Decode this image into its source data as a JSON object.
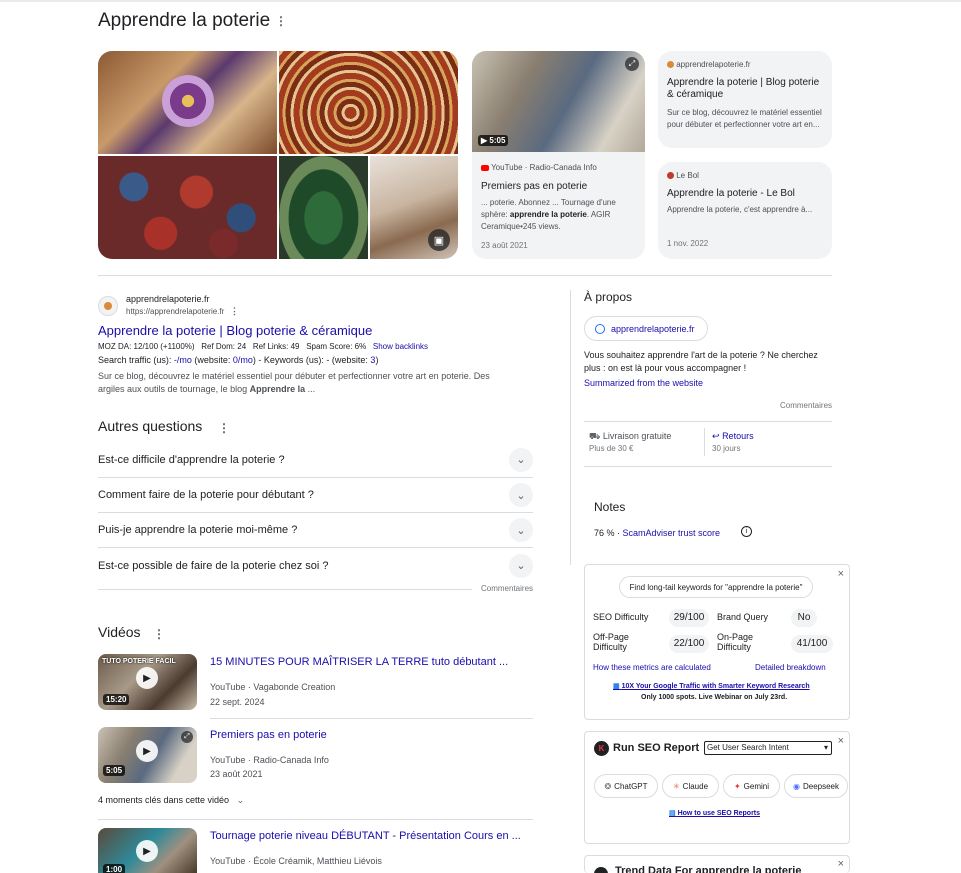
{
  "header": {
    "title": "Apprendre la poterie"
  },
  "images_panel": {
    "video_card": {
      "duration": "5:05",
      "source": "YouTube · Radio-Canada Info",
      "title": "Premiers pas en poterie",
      "snippet_a": "... poterie. Abonnez ... Tournage d'une sphère: ",
      "snippet_bold": "apprendre la poterie",
      "snippet_b": ". AGIR Ceramique•245 views.",
      "date": "23 août 2021"
    },
    "card1": {
      "site": "apprendrelapoterie.fr",
      "title": "Apprendre la poterie | Blog poterie & céramique",
      "snippet": "Sur ce blog, découvrez le matériel essentiel pour débuter et perfectionner votre art en..."
    },
    "card2": {
      "site": "Le Bol",
      "title": "Apprendre la poterie - Le Bol",
      "snippet": "Apprendre la poterie, c'est apprendre à...",
      "date": "1 nov. 2022"
    }
  },
  "result": {
    "site_name": "apprendrelapoterie.fr",
    "url": "https://apprendrelapoterie.fr",
    "title": "Apprendre la poterie | Blog poterie & céramique",
    "moz": "MOZ DA: 12/100 (+1100%)",
    "ref_dom": "Ref Dom: 24",
    "ref_links": "Ref Links: 49",
    "spam": "Spam Score: 6%",
    "backlinks": "Show backlinks",
    "traffic_a": "Search traffic (us): ",
    "traffic_mo": "-/mo",
    "traffic_b": " (website: ",
    "traffic_mo2": "0/mo",
    "traffic_c": ") - Keywords (us): - (website: ",
    "traffic_kw": "3",
    "traffic_d": ")",
    "snippet_a": "Sur ce blog, découvrez le matériel essentiel pour débuter et perfectionner votre art en poterie. Des argiles aux outils de tournage, le blog ",
    "snippet_bold": "Apprendre la",
    "snippet_b": " ..."
  },
  "questions": {
    "title": "Autres questions",
    "items": [
      "Est-ce difficile d'apprendre la poterie ?",
      "Comment faire de la poterie pour débutant ?",
      "Puis-je apprendre la poterie moi-même ?",
      "Est-ce possible de faire de la poterie chez soi ?"
    ],
    "feedback": "Commentaires"
  },
  "videos": {
    "title": "Vidéos",
    "items": [
      {
        "title": "15 MINUTES POUR MAÎTRISER LA TERRE tuto débutant ...",
        "source": "YouTube · Vagabonde Creation",
        "date": "22 sept. 2024",
        "duration": "15:20",
        "overlay": "TUTO POTERIE FACIL"
      },
      {
        "title": "Premiers pas en poterie",
        "source": "YouTube · Radio-Canada Info",
        "date": "23 août 2021",
        "duration": "5:05",
        "overlay": ""
      },
      {
        "title": "Tournage poterie niveau DÉBUTANT - Présentation Cours en ...",
        "source": "YouTube · École Créamik, Matthieu Liévois",
        "date": "",
        "duration": "1:00",
        "overlay": ""
      }
    ],
    "moments": "4 moments clés dans cette vidéo"
  },
  "about": {
    "title": "À propos",
    "site_chip": "apprendrelapoterie.fr",
    "desc": "Vous souhaitez apprendre l'art de la poterie ? Ne cherchez plus : on est là pour vous accompagner !",
    "summarized": "Summarized from the website",
    "feedback": "Commentaires",
    "shipping": "Livraison gratuite",
    "shipping_sub": "Plus de 30 €",
    "returns": "Retours",
    "returns_sub": "30 jours"
  },
  "notes": {
    "title": "Notes",
    "score": "76 %",
    "sep": " · ",
    "score_link": "ScamAdviser trust score"
  },
  "seo": {
    "find_btn": "Find long-tail keywords for \"apprendre la poterie\"",
    "difficulty_label": "SEO Difficulty",
    "difficulty": "29/100",
    "brand_label": "Brand Query",
    "brand": "No",
    "offpage_label": "Off-Page Difficulty",
    "offpage": "22/100",
    "onpage_label": "On-Page Difficulty",
    "onpage": "41/100",
    "how_link": "How these metrics are calculated",
    "breakdown_link": "Detailed breakdown",
    "promo": "10X Your Google Traffic with Smarter Keyword Research",
    "promo_sub": "Only 1000 spots. Live Webinar on July 23rd."
  },
  "report": {
    "title": "Run SEO Report",
    "select": "Get User Search Intent",
    "buttons": [
      "ChatGPT",
      "Claude",
      "Gemini",
      "Deepseek"
    ],
    "how_link": "How to use SEO Reports"
  },
  "trend": {
    "title": "Trend Data For apprendre la poterie"
  },
  "colors": {
    "link": "#1a0dab",
    "youtube": "#ff0000",
    "accent": "#1a73e8"
  }
}
